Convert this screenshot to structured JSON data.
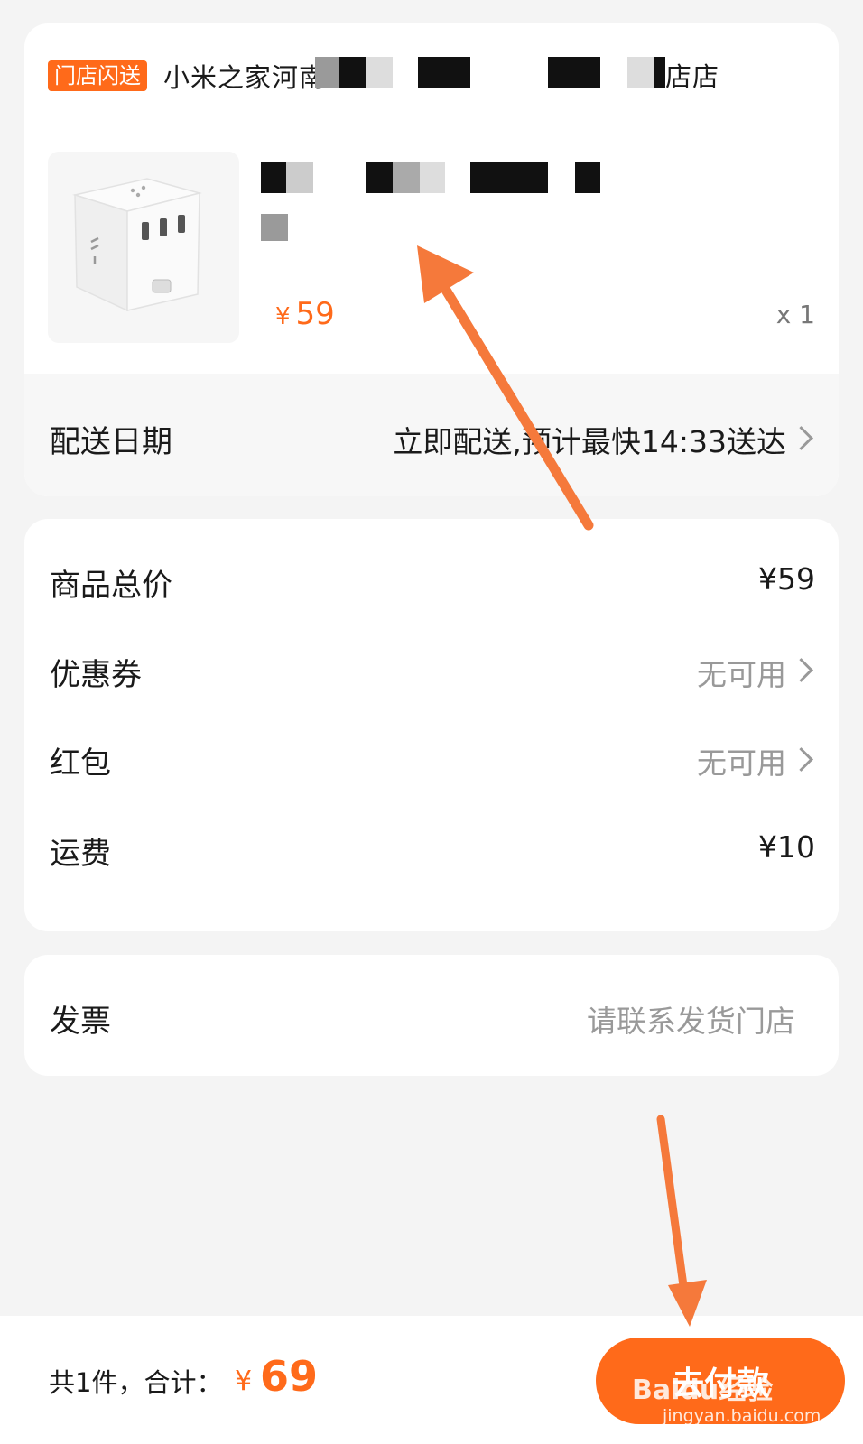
{
  "order": {
    "store_tag": "门店闪送",
    "store_name_start": "小米之家河南",
    "store_name_end": "店店",
    "product_price": "59",
    "currency_symbol": "¥",
    "quantity": "x 1",
    "thumbnail_icon": "power-strip-cube-image",
    "delivery_label": "配送日期",
    "delivery_value": "立即配送,预计最快14:33送达"
  },
  "price": {
    "rows": [
      {
        "label": "商品总价",
        "value": "¥59"
      },
      {
        "label": "优惠券",
        "value": "无可用"
      },
      {
        "label": "红包",
        "value": "无可用"
      },
      {
        "label": "运费",
        "value": "¥10"
      }
    ]
  },
  "invoice": {
    "label": "发票",
    "value": "请联系发货门店"
  },
  "footer": {
    "summary": "共1件，合计：",
    "currency_symbol": "¥",
    "total": "69",
    "pay_button": "去付款"
  },
  "watermark": {
    "text": "Baidu经验",
    "url": "jingyan.baidu.com"
  },
  "colors": {
    "accent": "#ff6a1a",
    "background": "#f4f4f4",
    "annotation_arrow": "#f5793b"
  }
}
